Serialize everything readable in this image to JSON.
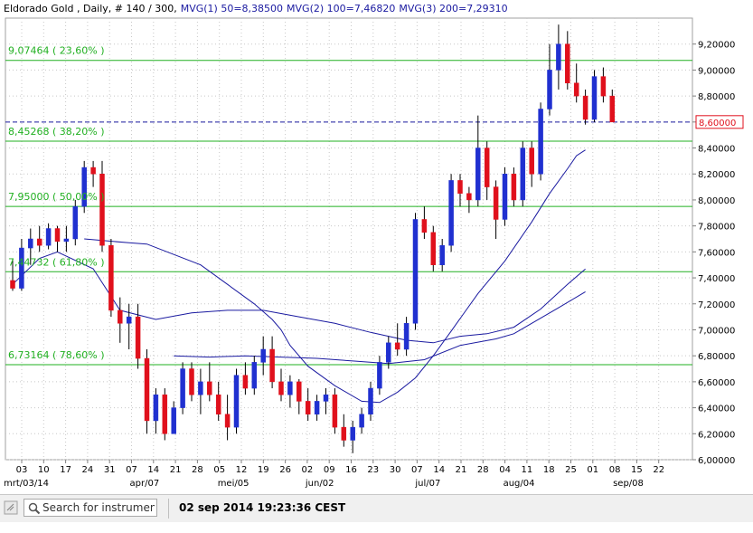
{
  "header": {
    "instrument": "Eldorado Gold , Daily, # 140 / 300,",
    "mvg1": "MVG(1) 50=8,38500",
    "mvg2": "MVG(2) 100=7,46820",
    "mvg3": "MVG(3) 200=7,29310"
  },
  "status_bar": {
    "search_placeholder": "Search for instrument",
    "timestamp": "02 sep 2014 19:23:36 CEST"
  },
  "colors": {
    "up_candle": "#2030d0",
    "down_candle": "#e0101c",
    "fib_line": "#22b022",
    "fib_label": "#22b022",
    "ma_line": "#1a1aa0",
    "price_line": "#1a1aa0",
    "price_box": "#e0101c",
    "axis_text": "#000000"
  },
  "chart_data": {
    "type": "candlestick",
    "title": "Eldorado Gold , Daily, # 140 / 300,",
    "ylim": [
      6.0,
      9.4
    ],
    "y_ticks": [
      "6,00000",
      "6,20000",
      "6,40000",
      "6,60000",
      "6,80000",
      "7,00000",
      "7,20000",
      "7,40000",
      "7,60000",
      "7,80000",
      "8,00000",
      "8,20000",
      "8,40000",
      "8,60000",
      "8,80000",
      "9,00000",
      "9,20000"
    ],
    "y_tick_values": [
      6.0,
      6.2,
      6.4,
      6.6,
      6.8,
      7.0,
      7.2,
      7.4,
      7.6,
      7.8,
      8.0,
      8.2,
      8.4,
      8.6,
      8.8,
      9.0,
      9.2
    ],
    "x_day_labels": [
      "03",
      "10",
      "17",
      "24",
      "31",
      "07",
      "14",
      "21",
      "28",
      "05",
      "12",
      "19",
      "26",
      "02",
      "09",
      "16",
      "23",
      "30",
      "07",
      "14",
      "21",
      "28",
      "04",
      "11",
      "18",
      "25",
      "01",
      "08",
      "15",
      "22"
    ],
    "x_month_labels": [
      {
        "label": "mrt/03/14",
        "day_index": 0
      },
      {
        "label": "apr/07",
        "day_index": 5
      },
      {
        "label": "mei/05",
        "day_index": 9
      },
      {
        "label": "jun/02",
        "day_index": 13
      },
      {
        "label": "jul/07",
        "day_index": 18
      },
      {
        "label": "aug/04",
        "day_index": 22
      },
      {
        "label": "sep/08",
        "day_index": 27
      }
    ],
    "fib_levels": [
      {
        "label": "9,07464 ( 23,60% )",
        "value": 9.07464
      },
      {
        "label": "8,45268 ( 38,20% )",
        "value": 8.45268
      },
      {
        "label": "7,95000 ( 50,00% )",
        "value": 7.95
      },
      {
        "label": "7,44732 ( 61,80% )",
        "value": 7.44732
      },
      {
        "label": "6,73164 ( 78,60% )",
        "value": 6.73164
      }
    ],
    "current_price": {
      "label": "8,60000",
      "value": 8.6
    },
    "series": [
      {
        "name": "MVG(1) 50",
        "last": 8.385,
        "points": [
          [
            8,
            7.7
          ],
          [
            13,
            7.67
          ],
          [
            15,
            7.66
          ],
          [
            18,
            7.58
          ],
          [
            21,
            7.5
          ],
          [
            24,
            7.35
          ],
          [
            27,
            7.2
          ],
          [
            29,
            7.08
          ],
          [
            30,
            7.0
          ],
          [
            31,
            6.88
          ],
          [
            33,
            6.72
          ],
          [
            36,
            6.57
          ],
          [
            39,
            6.45
          ],
          [
            41,
            6.44
          ],
          [
            43,
            6.52
          ],
          [
            45,
            6.63
          ],
          [
            47,
            6.8
          ],
          [
            49,
            6.99
          ],
          [
            52,
            7.28
          ],
          [
            55,
            7.53
          ],
          [
            58,
            7.83
          ],
          [
            60,
            8.05
          ],
          [
            62,
            8.24
          ],
          [
            63,
            8.34
          ],
          [
            64,
            8.385
          ]
        ]
      },
      {
        "name": "MVG(2) 100",
        "last": 7.4682,
        "points": [
          [
            0,
            7.35
          ],
          [
            3,
            7.55
          ],
          [
            5,
            7.6
          ],
          [
            9,
            7.47
          ],
          [
            12,
            7.15
          ],
          [
            16,
            7.08
          ],
          [
            20,
            7.13
          ],
          [
            24,
            7.15
          ],
          [
            28,
            7.15
          ],
          [
            32,
            7.1
          ],
          [
            36,
            7.05
          ],
          [
            40,
            6.98
          ],
          [
            44,
            6.92
          ],
          [
            47,
            6.9
          ],
          [
            50,
            6.95
          ],
          [
            53,
            6.97
          ],
          [
            56,
            7.02
          ],
          [
            59,
            7.16
          ],
          [
            62,
            7.35
          ],
          [
            64,
            7.4682
          ]
        ]
      },
      {
        "name": "MVG(3) 200",
        "last": 7.2931,
        "points": [
          [
            18,
            6.8
          ],
          [
            22,
            6.79
          ],
          [
            26,
            6.8
          ],
          [
            30,
            6.79
          ],
          [
            34,
            6.78
          ],
          [
            38,
            6.76
          ],
          [
            42,
            6.74
          ],
          [
            46,
            6.77
          ],
          [
            50,
            6.88
          ],
          [
            54,
            6.93
          ],
          [
            56,
            6.97
          ],
          [
            58,
            7.05
          ],
          [
            61,
            7.17
          ],
          [
            64,
            7.2931
          ]
        ]
      }
    ],
    "candles": [
      {
        "o": 7.38,
        "h": 7.55,
        "l": 7.3,
        "c": 7.32
      },
      {
        "o": 7.32,
        "h": 7.7,
        "l": 7.3,
        "c": 7.63
      },
      {
        "o": 7.63,
        "h": 7.78,
        "l": 7.5,
        "c": 7.7
      },
      {
        "o": 7.7,
        "h": 7.8,
        "l": 7.6,
        "c": 7.65
      },
      {
        "o": 7.65,
        "h": 7.82,
        "l": 7.62,
        "c": 7.78
      },
      {
        "o": 7.78,
        "h": 7.8,
        "l": 7.6,
        "c": 7.68
      },
      {
        "o": 7.68,
        "h": 7.8,
        "l": 7.6,
        "c": 7.7
      },
      {
        "o": 7.7,
        "h": 8.0,
        "l": 7.65,
        "c": 7.95
      },
      {
        "o": 7.95,
        "h": 8.3,
        "l": 7.9,
        "c": 8.25
      },
      {
        "o": 8.25,
        "h": 8.3,
        "l": 8.1,
        "c": 8.2
      },
      {
        "o": 8.2,
        "h": 8.3,
        "l": 7.6,
        "c": 7.65
      },
      {
        "o": 7.65,
        "h": 7.7,
        "l": 7.1,
        "c": 7.15
      },
      {
        "o": 7.15,
        "h": 7.25,
        "l": 6.9,
        "c": 7.05
      },
      {
        "o": 7.05,
        "h": 7.2,
        "l": 6.85,
        "c": 7.1
      },
      {
        "o": 7.1,
        "h": 7.2,
        "l": 6.7,
        "c": 6.78
      },
      {
        "o": 6.78,
        "h": 6.85,
        "l": 6.2,
        "c": 6.3
      },
      {
        "o": 6.3,
        "h": 6.55,
        "l": 6.2,
        "c": 6.5
      },
      {
        "o": 6.5,
        "h": 6.55,
        "l": 6.15,
        "c": 6.2
      },
      {
        "o": 6.2,
        "h": 6.45,
        "l": 6.2,
        "c": 6.4
      },
      {
        "o": 6.4,
        "h": 6.75,
        "l": 6.35,
        "c": 6.7
      },
      {
        "o": 6.7,
        "h": 6.75,
        "l": 6.45,
        "c": 6.5
      },
      {
        "o": 6.5,
        "h": 6.7,
        "l": 6.35,
        "c": 6.6
      },
      {
        "o": 6.6,
        "h": 6.75,
        "l": 6.45,
        "c": 6.5
      },
      {
        "o": 6.5,
        "h": 6.6,
        "l": 6.3,
        "c": 6.35
      },
      {
        "o": 6.35,
        "h": 6.5,
        "l": 6.15,
        "c": 6.25
      },
      {
        "o": 6.25,
        "h": 6.7,
        "l": 6.2,
        "c": 6.65
      },
      {
        "o": 6.65,
        "h": 6.75,
        "l": 6.5,
        "c": 6.55
      },
      {
        "o": 6.55,
        "h": 6.8,
        "l": 6.5,
        "c": 6.75
      },
      {
        "o": 6.75,
        "h": 6.95,
        "l": 6.65,
        "c": 6.85
      },
      {
        "o": 6.85,
        "h": 6.95,
        "l": 6.55,
        "c": 6.6
      },
      {
        "o": 6.6,
        "h": 6.7,
        "l": 6.45,
        "c": 6.5
      },
      {
        "o": 6.5,
        "h": 6.65,
        "l": 6.4,
        "c": 6.6
      },
      {
        "o": 6.6,
        "h": 6.62,
        "l": 6.35,
        "c": 6.45
      },
      {
        "o": 6.45,
        "h": 6.55,
        "l": 6.3,
        "c": 6.35
      },
      {
        "o": 6.35,
        "h": 6.5,
        "l": 6.3,
        "c": 6.45
      },
      {
        "o": 6.45,
        "h": 6.55,
        "l": 6.35,
        "c": 6.5
      },
      {
        "o": 6.5,
        "h": 6.55,
        "l": 6.2,
        "c": 6.25
      },
      {
        "o": 6.25,
        "h": 6.35,
        "l": 6.1,
        "c": 6.15
      },
      {
        "o": 6.15,
        "h": 6.3,
        "l": 6.05,
        "c": 6.25
      },
      {
        "o": 6.25,
        "h": 6.4,
        "l": 6.2,
        "c": 6.35
      },
      {
        "o": 6.35,
        "h": 6.6,
        "l": 6.3,
        "c": 6.55
      },
      {
        "o": 6.55,
        "h": 6.8,
        "l": 6.5,
        "c": 6.75
      },
      {
        "o": 6.75,
        "h": 6.95,
        "l": 6.7,
        "c": 6.9
      },
      {
        "o": 6.9,
        "h": 7.05,
        "l": 6.8,
        "c": 6.85
      },
      {
        "o": 6.85,
        "h": 7.1,
        "l": 6.8,
        "c": 7.05
      },
      {
        "o": 7.05,
        "h": 7.9,
        "l": 7.0,
        "c": 7.85
      },
      {
        "o": 7.85,
        "h": 7.95,
        "l": 7.7,
        "c": 7.75
      },
      {
        "o": 7.75,
        "h": 7.8,
        "l": 7.45,
        "c": 7.5
      },
      {
        "o": 7.5,
        "h": 7.7,
        "l": 7.45,
        "c": 7.65
      },
      {
        "o": 7.65,
        "h": 8.2,
        "l": 7.6,
        "c": 8.15
      },
      {
        "o": 8.15,
        "h": 8.2,
        "l": 7.95,
        "c": 8.05
      },
      {
        "o": 8.05,
        "h": 8.1,
        "l": 7.9,
        "c": 8.0
      },
      {
        "o": 8.0,
        "h": 8.65,
        "l": 7.95,
        "c": 8.4
      },
      {
        "o": 8.4,
        "h": 8.45,
        "l": 8.0,
        "c": 8.1
      },
      {
        "o": 8.1,
        "h": 8.15,
        "l": 7.7,
        "c": 7.85
      },
      {
        "o": 7.85,
        "h": 8.25,
        "l": 7.8,
        "c": 8.2
      },
      {
        "o": 8.2,
        "h": 8.25,
        "l": 7.95,
        "c": 8.0
      },
      {
        "o": 8.0,
        "h": 8.45,
        "l": 7.95,
        "c": 8.4
      },
      {
        "o": 8.4,
        "h": 8.45,
        "l": 8.1,
        "c": 8.2
      },
      {
        "o": 8.2,
        "h": 8.75,
        "l": 8.15,
        "c": 8.7
      },
      {
        "o": 8.7,
        "h": 9.2,
        "l": 8.65,
        "c": 9.0
      },
      {
        "o": 9.0,
        "h": 9.35,
        "l": 8.85,
        "c": 9.2
      },
      {
        "o": 9.2,
        "h": 9.3,
        "l": 8.85,
        "c": 8.9
      },
      {
        "o": 8.9,
        "h": 9.05,
        "l": 8.75,
        "c": 8.8
      },
      {
        "o": 8.8,
        "h": 8.85,
        "l": 8.58,
        "c": 8.62
      },
      {
        "o": 8.62,
        "h": 9.0,
        "l": 8.6,
        "c": 8.95
      },
      {
        "o": 8.95,
        "h": 9.02,
        "l": 8.75,
        "c": 8.8
      },
      {
        "o": 8.8,
        "h": 8.85,
        "l": 8.6,
        "c": 8.6
      }
    ]
  }
}
